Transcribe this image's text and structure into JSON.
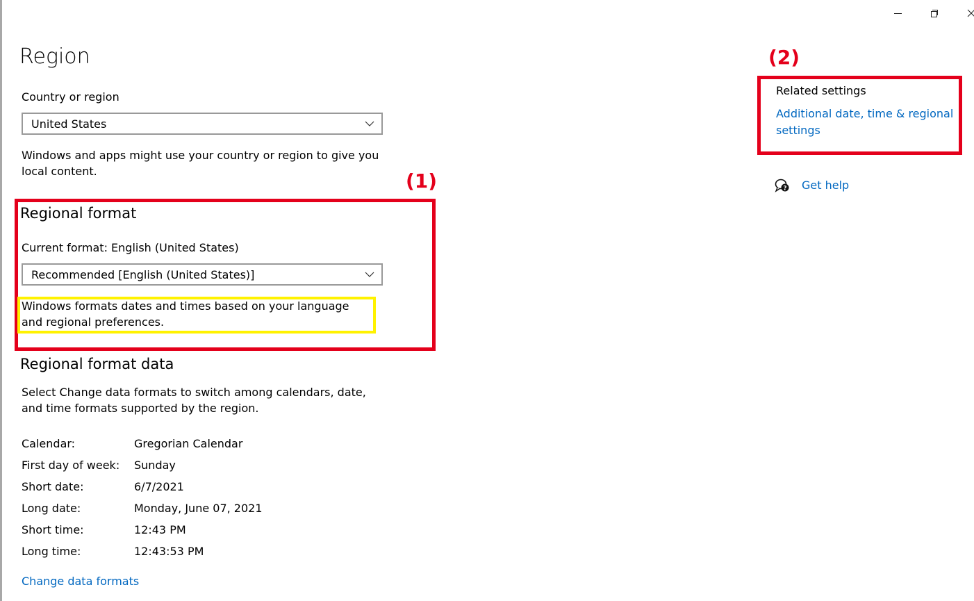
{
  "window": {
    "controls": {
      "minimize": "minimize",
      "maximize": "restore",
      "close": "close"
    }
  },
  "page": {
    "title": "Region"
  },
  "country": {
    "label": "Country or region",
    "selected": "United States",
    "description": "Windows and apps might use your country or region to give you local content."
  },
  "regional_format": {
    "title": "Regional format",
    "current_label": "Current format: English (United States)",
    "selected": "Recommended [English (United States)]",
    "description": "Windows formats dates and times based on your language and regional preferences."
  },
  "regional_format_data": {
    "title": "Regional format data",
    "description": "Select Change data formats to switch among calendars, date, and time formats supported by the region.",
    "rows": [
      {
        "key": "Calendar:",
        "value": "Gregorian Calendar"
      },
      {
        "key": "First day of week:",
        "value": "Sunday"
      },
      {
        "key": "Short date:",
        "value": "6/7/2021"
      },
      {
        "key": "Long date:",
        "value": "Monday, June 07, 2021"
      },
      {
        "key": "Short time:",
        "value": "12:43 PM"
      },
      {
        "key": "Long time:",
        "value": "12:43:53 PM"
      }
    ],
    "change_link": "Change data formats"
  },
  "related": {
    "title": "Related settings",
    "link": "Additional date, time & regional settings"
  },
  "help": {
    "label": "Get help",
    "icon": "help-chat-icon"
  },
  "annotations": {
    "tag1": "(1)",
    "tag2": "(2)",
    "red_color": "#e4001b",
    "yellow_color": "#fff200"
  },
  "colors": {
    "link": "#0067c0",
    "border": "#999999"
  }
}
